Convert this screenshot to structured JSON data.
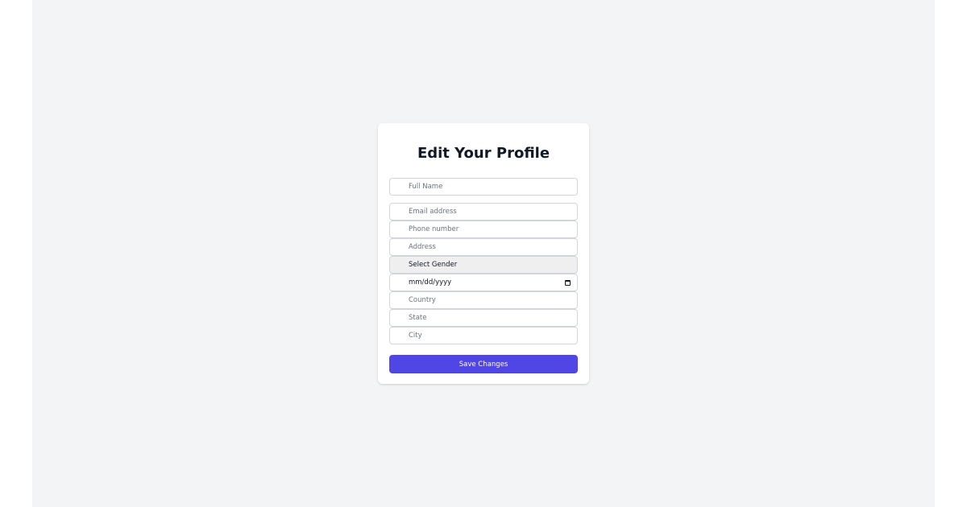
{
  "form": {
    "title": "Edit Your Profile",
    "fields": {
      "full_name": {
        "placeholder": "Full Name"
      },
      "email": {
        "placeholder": "Email address"
      },
      "phone": {
        "placeholder": "Phone number"
      },
      "address": {
        "placeholder": "Address"
      },
      "gender": {
        "selected": "Select Gender"
      },
      "date": {
        "value": "mm/dd/yyyy",
        "icon": "calendar-icon"
      },
      "country": {
        "placeholder": "Country"
      },
      "state": {
        "placeholder": "State"
      },
      "city": {
        "placeholder": "City"
      }
    },
    "save_label": "Save Changes"
  },
  "colors": {
    "page_background": "#f3f4f6",
    "card_background": "#ffffff",
    "primary_button": "#4f46e5",
    "title_text": "#111827",
    "input_border": "#d1d5db",
    "select_background": "#efefef"
  }
}
